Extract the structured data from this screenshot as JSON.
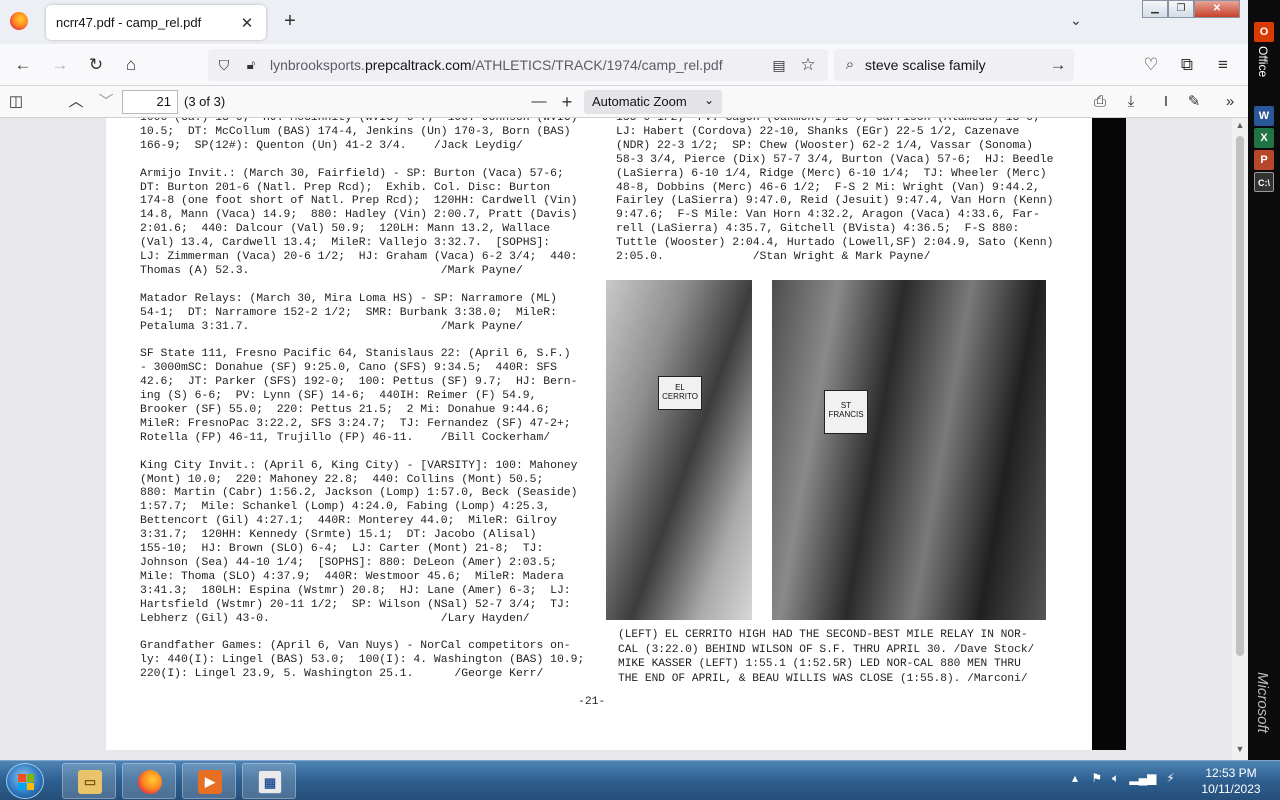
{
  "browser": {
    "tab_title": "ncrr47.pdf - camp_rel.pdf",
    "tab_close": "✕",
    "new_tab": "+",
    "url_prefix": "lynbrooksports.",
    "url_domain": "prepcaltrack.com",
    "url_path": "/ATHLETICS/TRACK/1974/camp_rel.pdf",
    "search_query": "steve scalise family"
  },
  "pdf_toolbar": {
    "page_number": "21",
    "page_count": "(3 of 3)",
    "zoom": "Automatic Zoom"
  },
  "document": {
    "left_column": "1000 (Ca.) 13-6;  HJ: McGinnity (WVIC) 6-7;  100: Johnson (WVIC)\n10.5;  DT: McCollum (BAS) 174-4, Jenkins (Un) 170-3, Born (BAS)\n166-9;  SP(12#): Quenton (Un) 41-2 3/4.    /Jack Leydig/\n\nArmijo Invit.: (March 30, Fairfield) - SP: Burton (Vaca) 57-6;\nDT: Burton 201-6 (Natl. Prep Rcd);  Exhib. Col. Disc: Burton\n174-8 (one foot short of Natl. Prep Rcd);  120HH: Cardwell (Vin)\n14.8, Mann (Vaca) 14.9;  880: Hadley (Vin) 2:00.7, Pratt (Davis)\n2:01.6;  440: Dalcour (Val) 50.9;  120LH: Mann 13.2, Wallace\n(Val) 13.4, Cardwell 13.4;  MileR: Vallejo 3:32.7.  [SOPHS]:\nLJ: Zimmerman (Vaca) 20-6 1/2;  HJ: Graham (Vaca) 6-2 3/4;  440:\nThomas (A) 52.3.                            /Mark Payne/\n\nMatador Relays: (March 30, Mira Loma HS) - SP: Narramore (ML)\n54-1;  DT: Narramore 152-2 1/2;  SMR: Burbank 3:38.0;  MileR:\nPetaluma 3:31.7.                            /Mark Payne/\n\nSF State 111, Fresno Pacific 64, Stanislaus 22: (April 6, S.F.)\n- 3000mSC: Donahue (SF) 9:25.0, Cano (SFS) 9:34.5;  440R: SFS\n42.6;  JT: Parker (SFS) 192-0;  100: Pettus (SF) 9.7;  HJ: Bern-\ning (S) 6-6;  PV: Lynn (SF) 14-6;  440IH: Reimer (F) 54.9,\nBrooker (SF) 55.0;  220: Pettus 21.5;  2 Mi: Donahue 9:44.6;\nMileR: FresnoPac 3:22.2, SFS 3:24.7;  TJ: Fernandez (SF) 47-2+;\nRotella (FP) 46-11, Trujillo (FP) 46-11.    /Bill Cockerham/\n\nKing City Invit.: (April 6, King City) - [VARSITY]: 100: Mahoney\n(Mont) 10.0;  220: Mahoney 22.8;  440: Collins (Mont) 50.5;\n880: Martin (Cabr) 1:56.2, Jackson (Lomp) 1:57.0, Beck (Seaside)\n1:57.7;  Mile: Schankel (Lomp) 4:24.0, Fabing (Lomp) 4:25.3,\nBettencort (Gil) 4:27.1;  440R: Monterey 44.0;  MileR: Gilroy\n3:31.7;  120HH: Kennedy (Srmte) 15.1;  DT: Jacobo (Alisal)\n155-10;  HJ: Brown (SLO) 6-4;  LJ: Carter (Mont) 21-8;  TJ:\nJohnson (Sea) 44-10 1/4;  [SOPHS]: 880: DeLeon (Amer) 2:03.5;\nMile: Thoma (SLO) 4:37.9;  440R: Westmoor 45.6;  MileR: Madera\n3:41.3;  180LH: Espina (Wstmr) 20.8;  HJ: Lane (Amer) 6-3;  LJ:\nHartsfield (Wstmr) 20-11 1/2;  SP: Wilson (NSal) 52-7 3/4;  TJ:\nLebherz (Gil) 43-0.                         /Lary Hayden/\n\nGrandfather Games: (April 6, Van Nuys) - NorCal competitors on-\nly: 440(I): Lingel (BAS) 53.0;  100(I): 4. Washington (BAS) 10.9;\n220(I): Lingel 23.9, 5. Washington 25.1.      /George Kerr/",
    "right_column": "158-0 1/2;  PV: Gagon (Oakmont) 15-0, Garrison (Alameda) 13-6;\nLJ: Habert (Cordova) 22-10, Shanks (EGr) 22-5 1/2, Cazenave\n(NDR) 22-3 1/2;  SP: Chew (Wooster) 62-2 1/4, Vassar (Sonoma)\n58-3 3/4, Pierce (Dix) 57-7 3/4, Burton (Vaca) 57-6;  HJ: Beedle\n(LaSierra) 6-10 1/4, Ridge (Merc) 6-10 1/4;  TJ: Wheeler (Merc)\n48-8, Dobbins (Merc) 46-6 1/2;  F-S 2 Mi: Wright (Van) 9:44.2,\nFairley (LaSierra) 9:47.0, Reid (Jesuit) 9:47.4, Van Horn (Kenn)\n9:47.6;  F-S Mile: Van Horn 4:32.2, Aragon (Vaca) 4:33.6, Far-\nrell (LaSierra) 4:35.7, Gitchell (BVista) 4:36.5;  F-S 880:\nTuttle (Wooster) 2:04.4, Hurtado (Lowell,SF) 2:04.9, Sato (Kenn)\n2:05.0.             /Stan Wright & Mark Payne/",
    "caption": "(LEFT) EL CERRITO HIGH HAD THE SECOND-BEST MILE RELAY IN NOR-\nCAL (3:22.0) BEHIND WILSON OF S.F. THRU APRIL 30. /Dave Stock/\nMIKE KASSER (LEFT) 1:55.1 (1:52.5R) LED NOR-CAL 880 MEN THRU\nTHE END OF APRIL, & BEAU WILLIS WAS CLOSE (1:55.8). /Marconi/",
    "photo_left_jersey": "EL CERRITO",
    "photo_right_jersey": "ST FRANCIS",
    "page_number_label": "-21-"
  },
  "side_panel": {
    "office_label": "Office",
    "brand_label": "Microsoft"
  },
  "taskbar": {
    "time": "12:53 PM",
    "date": "10/11/2023"
  }
}
